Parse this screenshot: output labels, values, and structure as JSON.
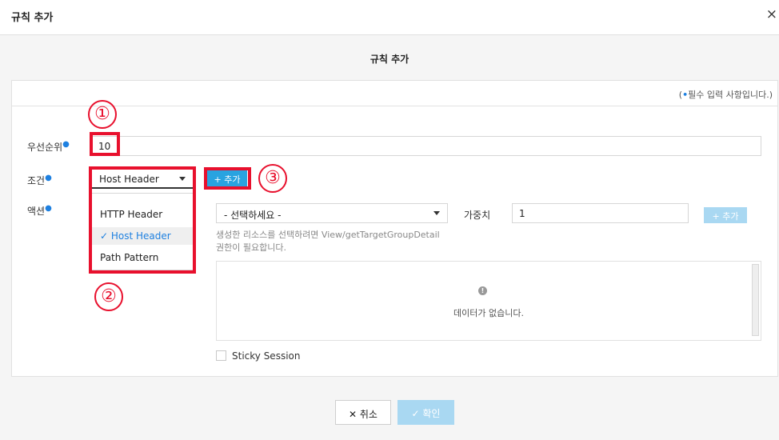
{
  "dialog": {
    "title": "규칙 추가",
    "close_icon": "×",
    "subtitle": "규칙 추가"
  },
  "form": {
    "required_note_prefix": "(",
    "required_note_dot": "•",
    "required_note_text": "필수 입력 사항입니다.)",
    "priority": {
      "label": "우선순위",
      "value": "10"
    },
    "condition": {
      "label": "조건",
      "selected": "Host Header",
      "add_button": "+ 추가",
      "options": [
        "HTTP Header",
        "Host Header",
        "Path Pattern"
      ],
      "selected_index": 1,
      "check_icon": "✓"
    },
    "action": {
      "label": "액션",
      "select_placeholder": "- 선택하세요 -",
      "weight_label": "가중치",
      "weight_value": "1",
      "add_button": "+ 추가",
      "hint_line1": "생성한 리소스를 선택하려면 View/getTargetGroupDetail",
      "hint_line2": "권한이 필요합니다.",
      "empty_icon": "!",
      "empty_text": "데이터가 없습니다."
    },
    "sticky_session_label": "Sticky Session"
  },
  "footer": {
    "cancel_label": "✕ 취소",
    "confirm_label": "✓ 확인"
  },
  "annotations": {
    "circle_1": "①",
    "circle_2": "②",
    "circle_3": "③",
    "color": "#e8102d"
  }
}
